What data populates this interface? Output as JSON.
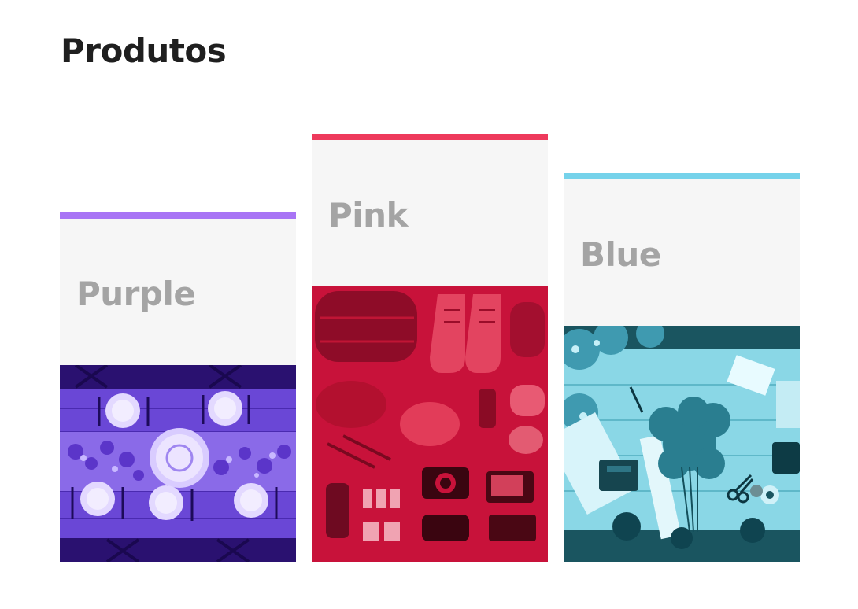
{
  "page": {
    "title": "Produtos"
  },
  "cards": [
    {
      "id": "purple",
      "title": "Purple",
      "accent": "#a874f5",
      "tint": "#6a3de8",
      "image": "dinner-table-photo"
    },
    {
      "id": "pink",
      "title": "Pink",
      "accent": "#ee3a5c",
      "tint": "#e0163c",
      "image": "travel-gear-flatlay-photo"
    },
    {
      "id": "blue",
      "title": "Blue",
      "accent": "#75d2ea",
      "tint": "#2fb6d6",
      "image": "flower-workbench-photo"
    }
  ]
}
